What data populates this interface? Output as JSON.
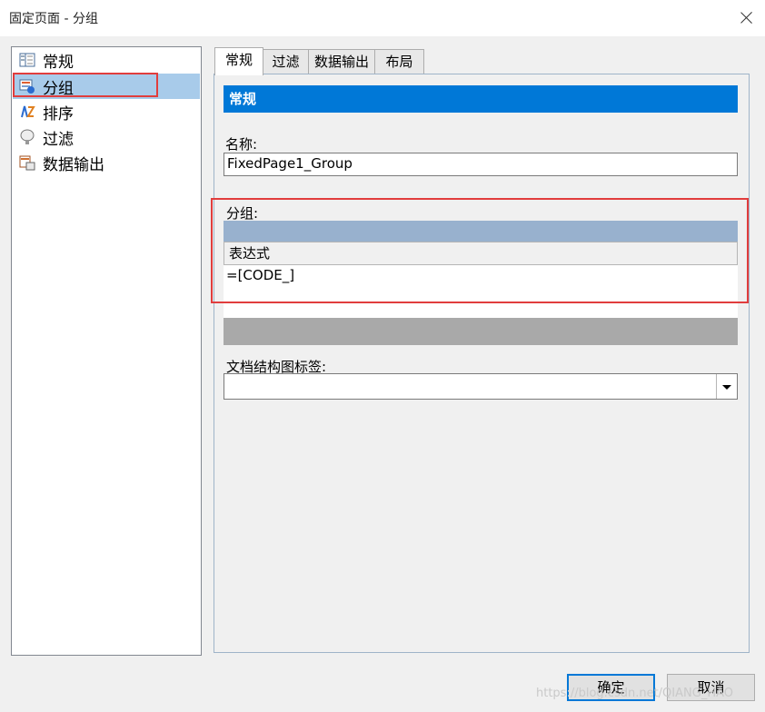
{
  "window": {
    "title": "固定页面 - 分组"
  },
  "sidebar": {
    "items": [
      {
        "label": "常规",
        "icon": "general-icon"
      },
      {
        "label": "分组",
        "icon": "group-icon",
        "selected": true
      },
      {
        "label": "排序",
        "icon": "sort-icon"
      },
      {
        "label": "过滤",
        "icon": "filter-icon"
      },
      {
        "label": "数据输出",
        "icon": "data-output-icon"
      }
    ]
  },
  "tabs": [
    "常规",
    "过滤",
    "数据输出",
    "布局"
  ],
  "section": {
    "header": "常规"
  },
  "form": {
    "name_label": "名称:",
    "name_value": "FixedPage1_Group",
    "group_label": "分组:",
    "grid_column_header": "表达式",
    "grid_rows": [
      "=[CODE_]"
    ],
    "docmap_label": "文档结构图标签:",
    "docmap_value": ""
  },
  "buttons": {
    "ok": "确定",
    "cancel": "取消"
  },
  "watermark": "https://blog.csdn.net/QIANG_HAO",
  "colors": {
    "accent": "#0078d7",
    "highlight": "#e13d3d",
    "selection": "#a8cbea"
  }
}
